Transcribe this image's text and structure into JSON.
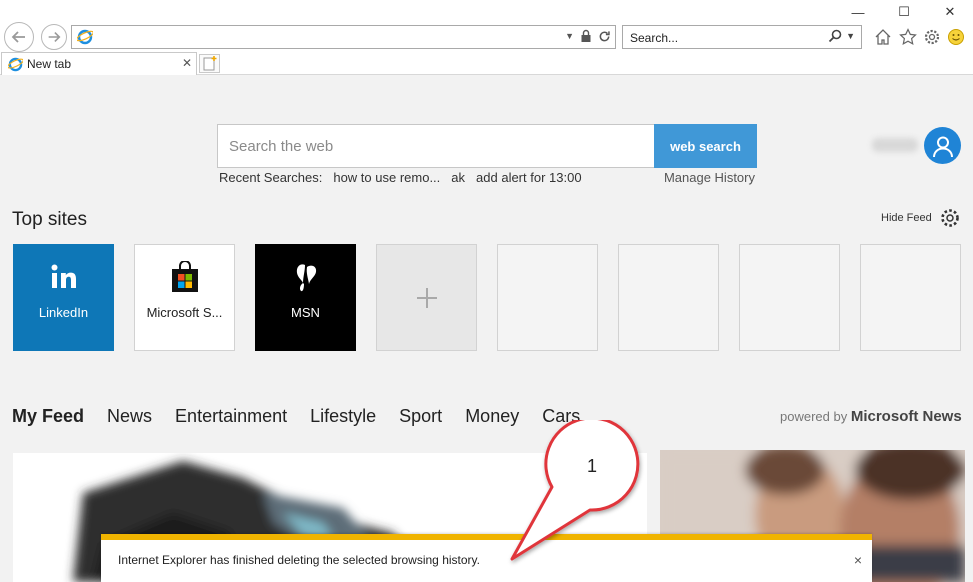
{
  "window": {
    "minimize_glyph": "—",
    "maximize_glyph": "☐",
    "close_glyph": "✕"
  },
  "address_bar": {
    "value": ""
  },
  "search_bar": {
    "placeholder": "Search..."
  },
  "tabs": [
    {
      "label": "New tab"
    }
  ],
  "page": {
    "web_search": {
      "placeholder": "Search the web",
      "button": "web search"
    },
    "recent": {
      "label": "Recent Searches:",
      "items": [
        "how to use remo...",
        "ak",
        "add alert for 13:00"
      ],
      "manage": "Manage History"
    },
    "top_sites": {
      "title": "Top sites",
      "hide_feed": "Hide Feed",
      "tiles": [
        {
          "label": "LinkedIn",
          "icon": "linkedin-icon"
        },
        {
          "label": "Microsoft S...",
          "icon": "microsoft-store-icon"
        },
        {
          "label": "MSN",
          "icon": "msn-butterfly-icon"
        },
        {
          "label": "",
          "icon": "plus-icon"
        }
      ]
    },
    "feed": {
      "tabs": [
        "My Feed",
        "News",
        "Entertainment",
        "Lifestyle",
        "Sport",
        "Money",
        "Cars"
      ],
      "powered_by": "powered by",
      "powered_brand": "Microsoft News"
    }
  },
  "notification": {
    "message": "Internet Explorer has finished deleting the selected browsing history.",
    "close": "×"
  },
  "callout": {
    "number": "1"
  },
  "colors": {
    "accent": "#4098d7",
    "linkedin": "#0e77b7",
    "notify_bar": "#f0b400",
    "callout_stroke": "#e0343a"
  }
}
